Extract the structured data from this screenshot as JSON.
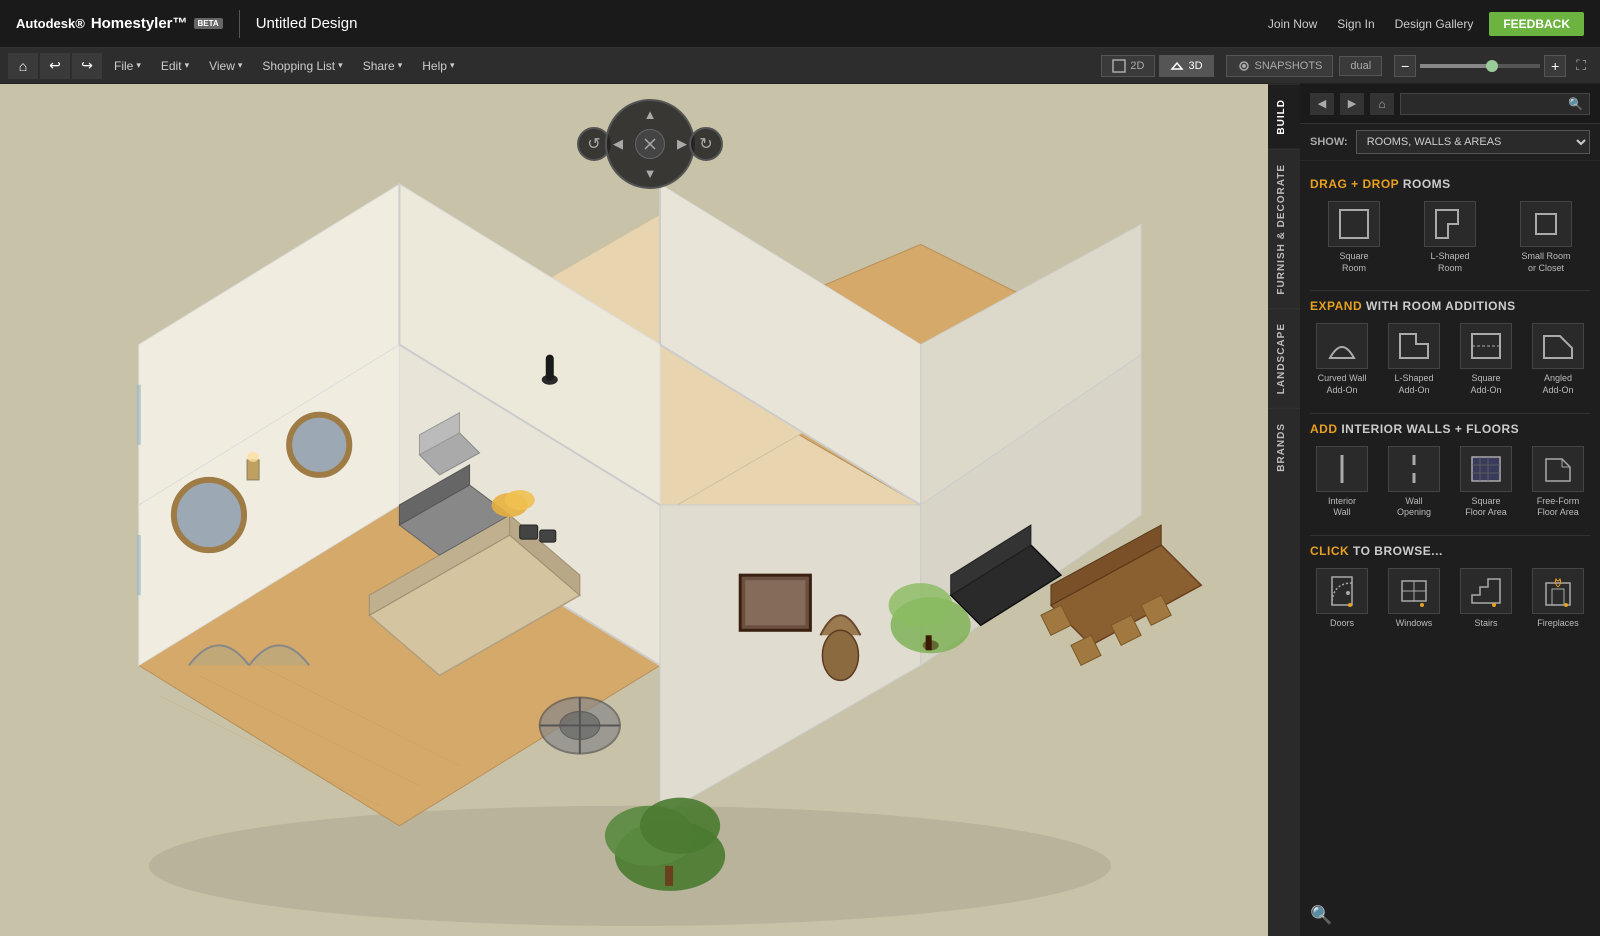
{
  "topbar": {
    "brand": "Autodesk®",
    "product": "Homestyler™",
    "beta_label": "BETA",
    "title": "Untitled Design",
    "nav_links": [
      "Join Now",
      "Sign In",
      "Design Gallery"
    ],
    "feedback_label": "FEEDBACK"
  },
  "menubar": {
    "file_label": "File",
    "edit_label": "Edit",
    "view_label": "View",
    "shopping_list_label": "Shopping List",
    "share_label": "Share",
    "help_label": "Help",
    "view_2d_label": "2D",
    "view_3d_label": "3D",
    "snapshots_label": "SNAPSHOTS",
    "dual_label": "dual",
    "zoom_level": 60
  },
  "panel": {
    "back_label": "◀",
    "forward_label": "▶",
    "home_label": "⌂",
    "search_placeholder": "",
    "show_label": "SHOW:",
    "show_option": "ROOMS, WALLS & AREAS",
    "tab_build": "BUILD",
    "tab_furnish": "FURNISH & DECORATE",
    "tab_landscape": "LANDSCAPE",
    "tab_brands": "BRANDS"
  },
  "build_panel": {
    "drag_drop_label": "DRAG + DROP",
    "rooms_label": "ROOMS",
    "expand_label": "EXPAND",
    "with_room_additions_label": "WITH ROOM ADDITIONS",
    "add_label": "ADD",
    "interior_walls_floors_label": "INTERIOR WALLS + FLOORS",
    "click_browse_label": "CLICK",
    "to_browse_label": "TO BROWSE...",
    "rooms": [
      {
        "label": "Square\nRoom",
        "icon": "square-room-icon"
      },
      {
        "label": "L-Shaped\nRoom",
        "icon": "l-shaped-room-icon"
      },
      {
        "label": "Small Room\nor Closet",
        "icon": "small-room-icon"
      }
    ],
    "additions": [
      {
        "label": "Curved Wall\nAdd-On",
        "icon": "curved-wall-icon"
      },
      {
        "label": "L-Shaped\nAdd-On",
        "icon": "l-shaped-addon-icon"
      },
      {
        "label": "Square\nAdd-On",
        "icon": "square-addon-icon"
      },
      {
        "label": "Angled\nAdd-On",
        "icon": "angled-addon-icon"
      }
    ],
    "walls_floors": [
      {
        "label": "Interior\nWall",
        "icon": "interior-wall-icon"
      },
      {
        "label": "Wall\nOpening",
        "icon": "wall-opening-icon"
      },
      {
        "label": "Square\nFloor Area",
        "icon": "square-floor-icon"
      },
      {
        "label": "Free-Form\nFloor Area",
        "icon": "freeform-floor-icon"
      }
    ],
    "browse_items": [
      {
        "label": "Doors",
        "icon": "doors-icon"
      },
      {
        "label": "Windows",
        "icon": "windows-icon"
      },
      {
        "label": "Stairs",
        "icon": "stairs-icon"
      },
      {
        "label": "Fireplaces",
        "icon": "fireplaces-icon"
      }
    ]
  },
  "colors": {
    "accent_orange": "#e8a020",
    "bg_dark": "#1e1e1e",
    "bg_darker": "#1a1a1a",
    "bg_medium": "#2a2a2a",
    "border": "#444444",
    "text_light": "#cccccc",
    "text_muted": "#888888",
    "green_feedback": "#6db33f",
    "canvas_bg": "#c8c3a8"
  }
}
